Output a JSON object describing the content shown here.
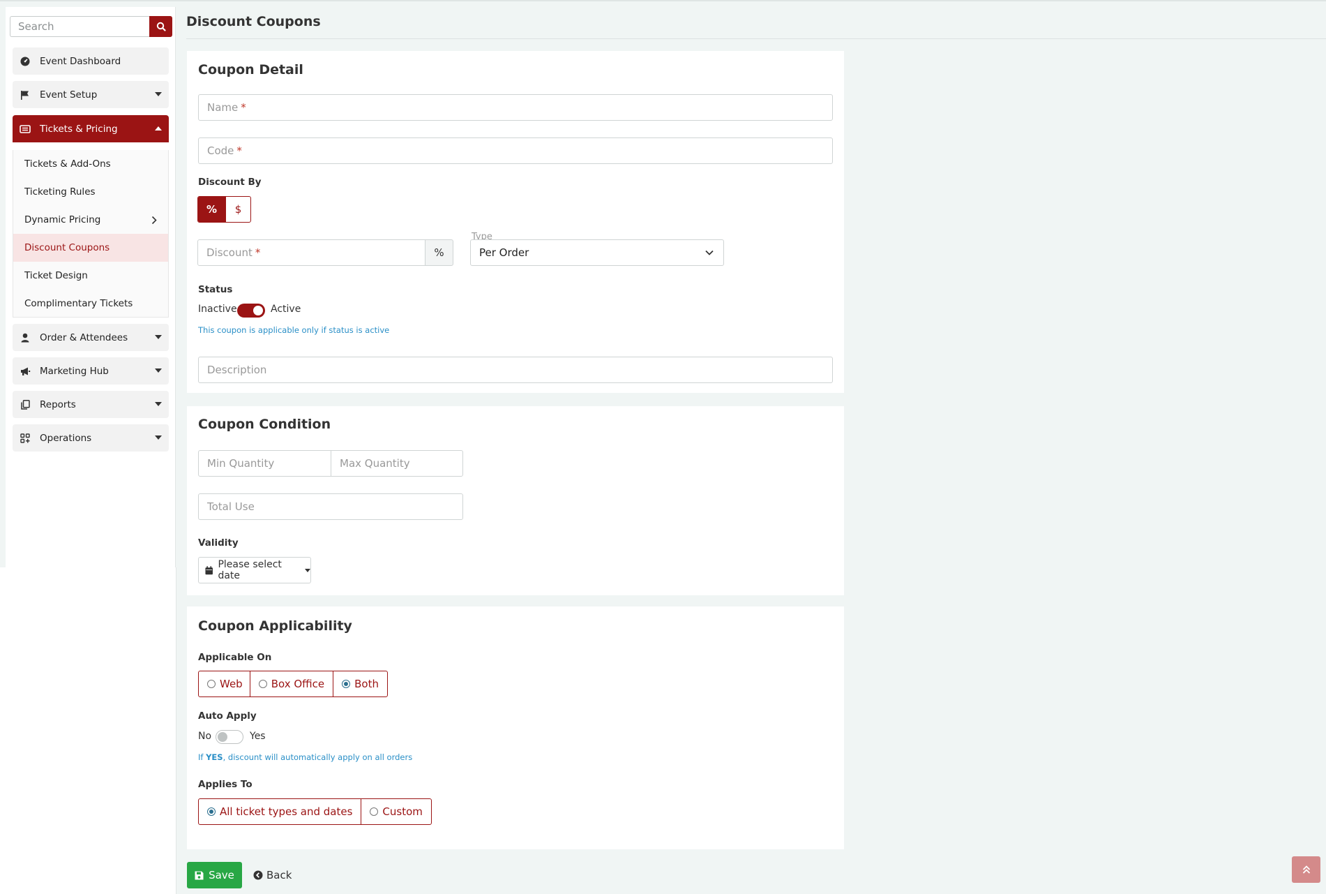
{
  "sidebar": {
    "search_placeholder": "Search",
    "items": [
      {
        "label": "Event Dashboard",
        "icon": "dashboard-icon"
      },
      {
        "label": "Event Setup",
        "icon": "flag-icon"
      },
      {
        "label": "Tickets & Pricing",
        "icon": "ticket-icon"
      },
      {
        "label": "Order & Attendees",
        "icon": "user-icon"
      },
      {
        "label": "Marketing Hub",
        "icon": "megaphone-icon"
      },
      {
        "label": "Reports",
        "icon": "copy-icon"
      },
      {
        "label": "Operations",
        "icon": "grid-plus-icon"
      }
    ],
    "sub_items": [
      "Tickets & Add-Ons",
      "Ticketing Rules",
      "Dynamic Pricing",
      "Discount Coupons",
      "Ticket Design",
      "Complimentary Tickets"
    ]
  },
  "page": {
    "title": "Discount Coupons"
  },
  "coupon_detail": {
    "title": "Coupon Detail",
    "name_placeholder": "Name",
    "code_placeholder": "Code",
    "required_mark": "*",
    "discount_by_label": "Discount By",
    "discount_by_options": [
      "%",
      "$"
    ],
    "discount_placeholder": "Discount",
    "discount_addon": "%",
    "type_label": "Type",
    "type_value": "Per Order",
    "status_label": "Status",
    "status_inactive": "Inactive",
    "status_active": "Active",
    "status_note": "This coupon is applicable only if status is active",
    "description_placeholder": "Description"
  },
  "coupon_condition": {
    "title": "Coupon Condition",
    "min_placeholder": "Min Quantity",
    "max_placeholder": "Max Quantity",
    "total_placeholder": "Total Use",
    "validity_label": "Validity",
    "validity_value": "Please select date"
  },
  "coupon_applicability": {
    "title": "Coupon Applicability",
    "applicable_on_label": "Applicable On",
    "applicable_on_options": [
      "Web",
      "Box Office",
      "Both"
    ],
    "auto_apply_label": "Auto Apply",
    "auto_no": "No",
    "auto_yes": "Yes",
    "auto_note_prefix": "If",
    "auto_note_bold": "YES",
    "auto_note_rest": ", discount will automatically apply on all orders",
    "applies_to_label": "Applies To",
    "applies_to_options": [
      "All ticket types and dates",
      "Custom"
    ]
  },
  "actions": {
    "save": "Save",
    "back": "Back"
  },
  "colors": {
    "brand": "#9b1414",
    "save": "#28a745",
    "link": "#2a8fc7"
  }
}
